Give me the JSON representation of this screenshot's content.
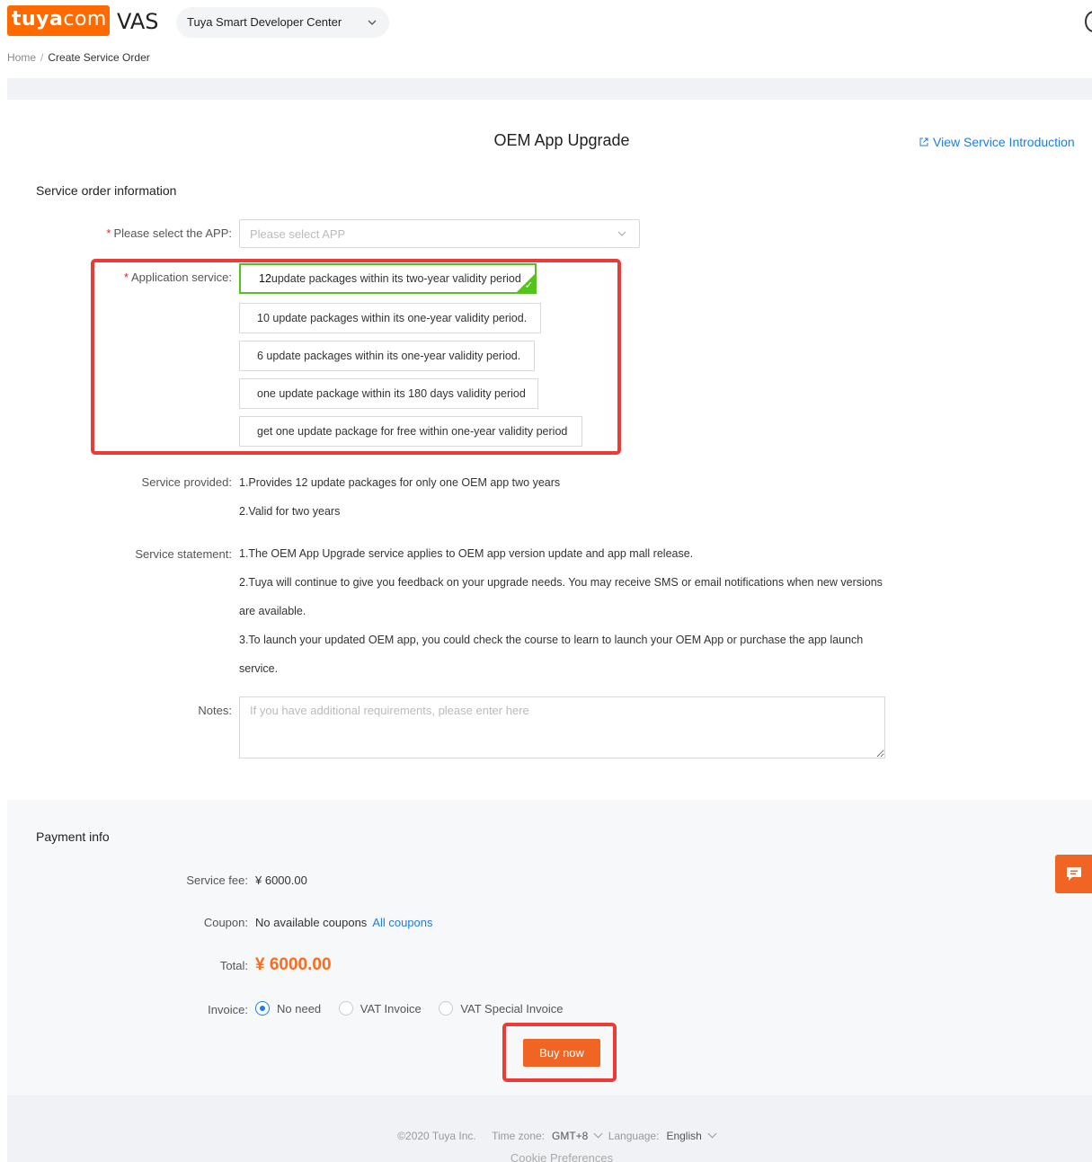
{
  "header": {
    "logo_text": "tuya",
    "logo_suffix": "com",
    "product": "VAS",
    "center_select": "Tuya Smart Developer Center"
  },
  "breadcrumb": {
    "home": "Home",
    "separator": "/",
    "current": "Create Service Order"
  },
  "page": {
    "title": "OEM App Upgrade",
    "view_intro": "View Service Introduction"
  },
  "order": {
    "section_title": "Service order information",
    "app_label": "Please select the APP",
    "app_placeholder": "Please select APP",
    "service_label": "Application service",
    "options": [
      {
        "bold": "12",
        "text": "update packages within its two-year validity period",
        "selected": true
      },
      {
        "bold": "10",
        "text": " update packages within its one-year validity period.",
        "selected": false
      },
      {
        "bold": "6",
        "text": " update packages within its one-year validity period.",
        "selected": false
      },
      {
        "pre": "one update package within its ",
        "bold": "180",
        "text": " days validity period",
        "selected": false
      },
      {
        "text": "get one update package for free within one-year validity period",
        "selected": false
      }
    ],
    "provided_label": "Service provided",
    "provided": [
      "1.Provides 12 update packages for only one OEM app two years",
      "2.Valid for two years"
    ],
    "statement_label": "Service statement",
    "statement": [
      "1.The OEM App Upgrade service applies to OEM app version update and app mall release.",
      "2.Tuya will continue to give you feedback on your upgrade needs. You may receive SMS or email notifications when new versions",
      "are available.",
      "3.To launch your updated OEM app, you could check the course to learn to launch your OEM App or purchase the app launch",
      "service."
    ],
    "notes_label": "Notes",
    "notes_placeholder": "If you have additional requirements, please enter here"
  },
  "payment": {
    "section_title": "Payment info",
    "fee_label": "Service fee",
    "fee_value": "¥ 6000.00",
    "coupon_label": "Coupon",
    "coupon_value": "No available coupons",
    "coupon_link": "All coupons",
    "total_label": "Total",
    "total_value": "¥ 6000.00",
    "invoice_label": "Invoice",
    "invoice_options": [
      "No need",
      "VAT Invoice",
      "VAT Special Invoice"
    ],
    "invoice_selected": "No need",
    "buy_label": "Buy now"
  },
  "footer": {
    "copyright": "©2020 Tuya Inc.",
    "timezone_label": "Time zone:",
    "timezone_value": "GMT+8",
    "language_label": "Language:",
    "language_value": "English",
    "cookie": "Cookie Preferences"
  },
  "colors": {
    "accent": "#f06524",
    "link": "#1e7ce8",
    "selected": "#52c41a",
    "highlight": "#ec3b35"
  }
}
